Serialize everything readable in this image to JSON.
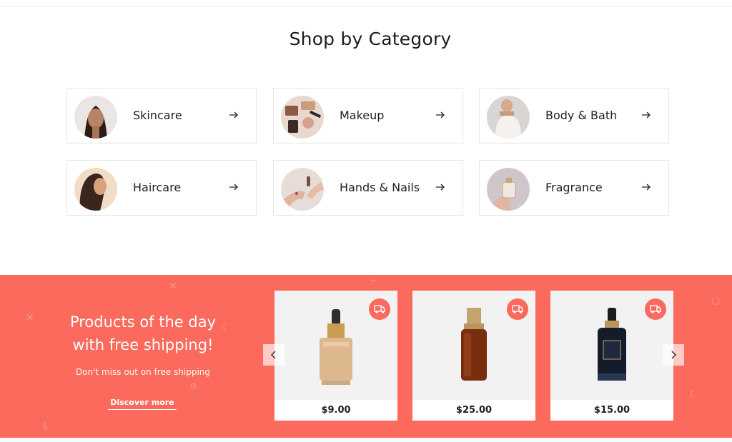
{
  "categories_section": {
    "title": "Shop by Category",
    "items": [
      {
        "label": "Skincare",
        "icon": "arrow-right-icon"
      },
      {
        "label": "Makeup",
        "icon": "arrow-right-icon"
      },
      {
        "label": "Body & Bath",
        "icon": "arrow-right-icon"
      },
      {
        "label": "Haircare",
        "icon": "arrow-right-icon"
      },
      {
        "label": "Hands & Nails",
        "icon": "arrow-right-icon"
      },
      {
        "label": "Fragrance",
        "icon": "arrow-right-icon"
      }
    ]
  },
  "promo": {
    "title_line1": "Products of the day",
    "title_line2": "with free shipping!",
    "subtitle": "Don't miss out on free shipping",
    "link_label": "Discover more",
    "background_color": "#fb6a5c",
    "products": [
      {
        "price": "$9.00",
        "badge_icon": "delivery-truck-icon"
      },
      {
        "price": "$25.00",
        "badge_icon": "delivery-truck-icon"
      },
      {
        "price": "$15.00",
        "badge_icon": "delivery-truck-icon"
      }
    ],
    "carousel": {
      "prev_icon": "chevron-left-icon",
      "next_icon": "chevron-right-icon"
    }
  }
}
